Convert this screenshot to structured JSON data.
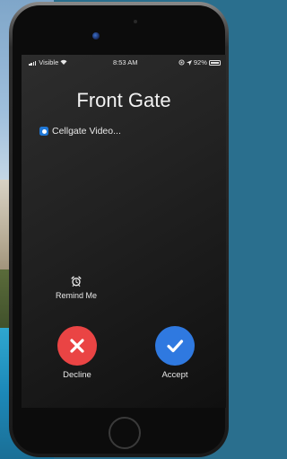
{
  "status_bar": {
    "carrier": "Visible",
    "time": "8:53 AM",
    "battery": "92%"
  },
  "call": {
    "caller": "Front Gate",
    "app_label": "Cellgate Video..."
  },
  "actions": {
    "remind_label": "Remind Me",
    "decline_label": "Decline",
    "accept_label": "Accept"
  },
  "colors": {
    "decline": "#ea4444",
    "accept": "#2f79e0"
  },
  "icons": {
    "remind": "alarm-clock-icon",
    "decline": "x-icon",
    "accept": "checkmark-icon",
    "app": "cellgate-app-icon"
  }
}
